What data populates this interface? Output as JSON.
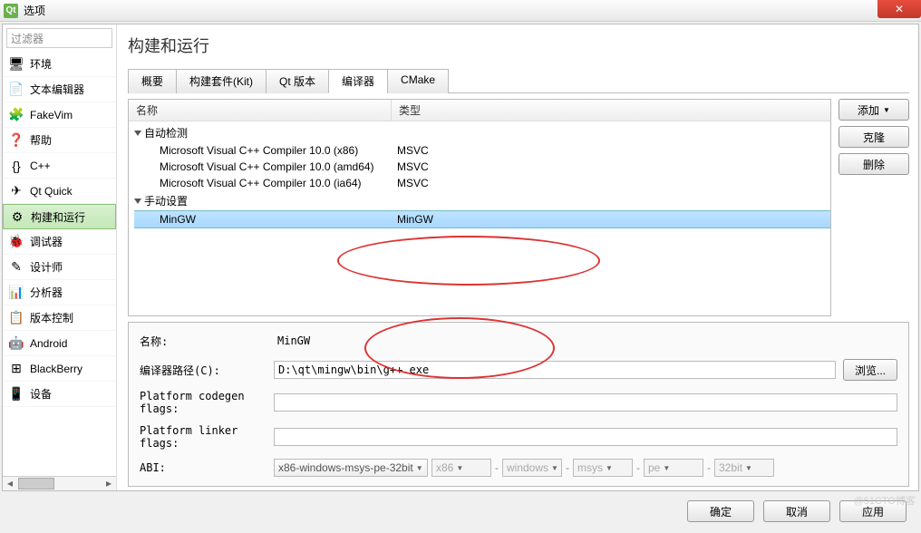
{
  "window": {
    "title": "选项",
    "close_glyph": "✕"
  },
  "sidebar": {
    "filter_placeholder": "过滤器",
    "items": [
      {
        "label": "环境",
        "icon": "🖥"
      },
      {
        "label": "文本编辑器",
        "icon": "📄"
      },
      {
        "label": "FakeVim",
        "icon": "🧩"
      },
      {
        "label": "帮助",
        "icon": "❓"
      },
      {
        "label": "C++",
        "icon": "{}"
      },
      {
        "label": "Qt Quick",
        "icon": "✈"
      },
      {
        "label": "构建和运行",
        "icon": "⚙",
        "active": true
      },
      {
        "label": "调试器",
        "icon": "🐞"
      },
      {
        "label": "设计师",
        "icon": "✎"
      },
      {
        "label": "分析器",
        "icon": "📊"
      },
      {
        "label": "版本控制",
        "icon": "📋"
      },
      {
        "label": "Android",
        "icon": "🤖"
      },
      {
        "label": "BlackBerry",
        "icon": "⊞"
      },
      {
        "label": "设备",
        "icon": "📱"
      }
    ]
  },
  "main": {
    "title": "构建和运行",
    "tabs": [
      {
        "label": "概要"
      },
      {
        "label": "构建套件(Kit)"
      },
      {
        "label": "Qt 版本"
      },
      {
        "label": "编译器",
        "active": true
      },
      {
        "label": "CMake"
      }
    ],
    "tree": {
      "header_name": "名称",
      "header_type": "类型",
      "groups": [
        {
          "label": "自动检测",
          "items": [
            {
              "name": "Microsoft Visual C++ Compiler 10.0 (x86)",
              "type": "MSVC"
            },
            {
              "name": "Microsoft Visual C++ Compiler 10.0 (amd64)",
              "type": "MSVC"
            },
            {
              "name": "Microsoft Visual C++ Compiler 10.0 (ia64)",
              "type": "MSVC"
            }
          ]
        },
        {
          "label": "手动设置",
          "items": [
            {
              "name": "MinGW",
              "type": "MinGW",
              "selected": true
            }
          ]
        }
      ]
    },
    "buttons": {
      "add": "添加",
      "clone": "克隆",
      "remove": "删除"
    },
    "detail": {
      "name_label": "名称:",
      "name_value": "MinGW",
      "path_label": "编译器路径(C):",
      "path_value": "D:\\qt\\mingw\\bin\\g++.exe",
      "browse": "浏览...",
      "codegen_label": "Platform codegen flags:",
      "codegen_value": "",
      "linker_label": "Platform linker flags:",
      "linker_value": "",
      "abi_label": "ABI:",
      "abi_combo": "x86-windows-msys-pe-32bit",
      "abi_parts": [
        "x86",
        "windows",
        "msys",
        "pe",
        "32bit"
      ]
    }
  },
  "footer": {
    "ok": "确定",
    "cancel": "取消",
    "apply": "应用"
  },
  "watermark": "@51CTO博客"
}
